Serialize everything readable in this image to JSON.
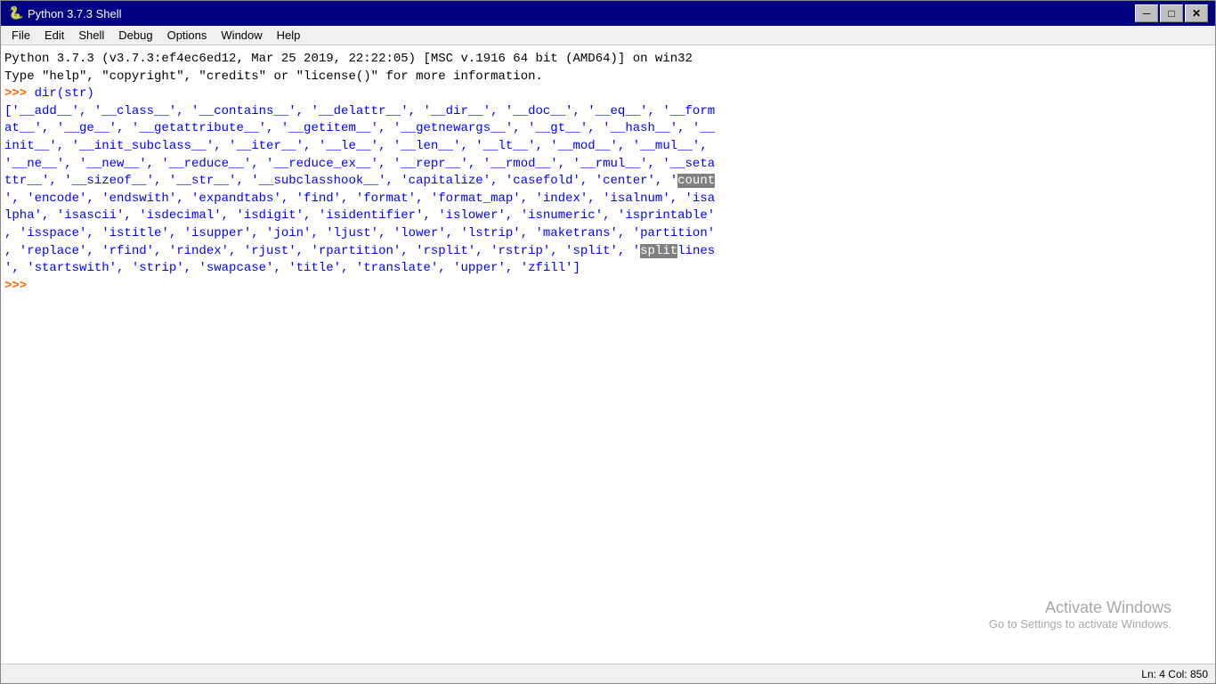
{
  "titleBar": {
    "icon": "🐍",
    "title": "Python 3.7.3 Shell",
    "minimizeLabel": "─",
    "maximizeLabel": "□",
    "closeLabel": "✕"
  },
  "menuBar": {
    "items": [
      "File",
      "Edit",
      "Shell",
      "Debug",
      "Options",
      "Window",
      "Help"
    ]
  },
  "console": {
    "line1": "Python 3.7.3 (v3.7.3:ef4ec6ed12, Mar 25 2019, 22:22:05) [MSC v.1916 64 bit (AMD64)] on win32",
    "line2": "Type \"help\", \"copyright\", \"credits\" or \"license()\" for more information.",
    "prompt1": ">>> ",
    "command1": "dir(str)",
    "output": "['__add__', '__class__', '__contains__', '__delattr__', '__dir__', '__doc__', '__eq__', '__form\nat__', '__ge__', '__getattribute__', '__getitem__', '__getnewargs__', '__gt__', '__hash__', '__\ninit__', '__init_subclass__', '__iter__', '__le__', '__len__', '__lt__', '__mod__', '__mul__',\n'__ne__', '__new__', '__reduce__', '__reduce_ex__', '__repr__', '__rmod__', '__rmul__', '__seta\nttr__', '__sizeof__', '__str__', '__subclasshook__', 'capitalize', 'casefold', 'center', 'count\n', 'encode', 'endswith', 'expandtabs', 'find', 'format', 'format_map', 'index', 'isalnum', 'isa\nlpha', 'isascii', 'isdecimal', 'isdigit', 'isidentifier', 'islower', 'isnumeric', 'isprintable'\n, 'isspace', 'istitle', 'isupper', 'join', 'ljust', 'lower', 'lstrip', 'maketrans', 'partition'\n, 'replace', 'rfind', 'rindex', 'rjust', 'rpartition', 'rsplit', 'rstrip', 'split', 'splitlines\n', 'startswith', 'strip', 'swapcase', 'title', 'translate', 'upper', 'zfill']",
    "prompt2": ">>> "
  },
  "statusBar": {
    "position": "Ln: 4   Col: 850"
  },
  "watermark": {
    "line1": "Activate Windows",
    "line2": "Go to Settings to activate Windows."
  }
}
